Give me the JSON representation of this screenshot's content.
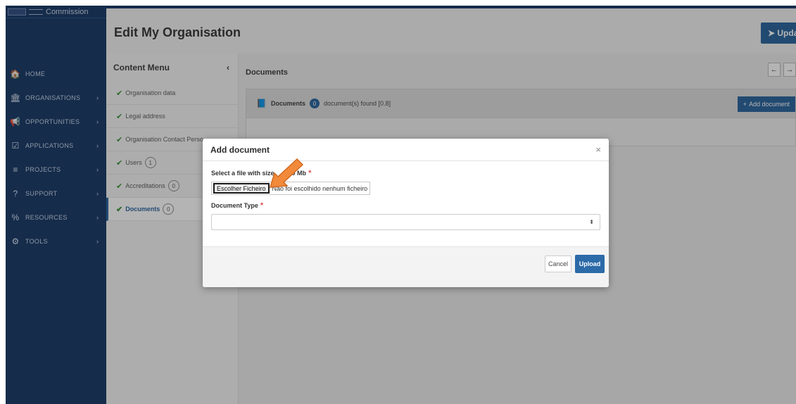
{
  "sidebar": {
    "logo_text": "Commission",
    "items": [
      {
        "icon": "home-icon",
        "glyph": "🏠",
        "label": "HOME",
        "chevron": ""
      },
      {
        "icon": "bank-icon",
        "glyph": "🏛",
        "label": "ORGANISATIONS",
        "chevron": "›"
      },
      {
        "icon": "megaphone-icon",
        "glyph": "📢",
        "label": "OPPORTUNITIES",
        "chevron": "›"
      },
      {
        "icon": "checklist-icon",
        "glyph": "☑",
        "label": "APPLICATIONS",
        "chevron": "›"
      },
      {
        "icon": "list-icon",
        "glyph": "≡",
        "label": "PROJECTS",
        "chevron": "›"
      },
      {
        "icon": "help-icon",
        "glyph": "?",
        "label": "SUPPORT",
        "chevron": "›"
      },
      {
        "icon": "link-icon",
        "glyph": "%",
        "label": "RESOURCES",
        "chevron": "›"
      },
      {
        "icon": "gears-icon",
        "glyph": "⚙",
        "label": "TOOLS",
        "chevron": "›"
      }
    ]
  },
  "header": {
    "title": "Edit My Organisation",
    "update_label": "Upda",
    "update_icon": "send-icon"
  },
  "content_menu": {
    "title": "Content Menu",
    "collapse_glyph": "‹",
    "items": [
      {
        "label": "Organisation data",
        "count": ""
      },
      {
        "label": "Legal address",
        "count": ""
      },
      {
        "label": "Organisation Contact Perso",
        "count": ""
      },
      {
        "label": "Users",
        "count": "1"
      },
      {
        "label": "Accreditations",
        "count": "0"
      },
      {
        "label": "Documents",
        "count": "0"
      }
    ]
  },
  "main": {
    "title": "Documents",
    "prev_glyph": "←",
    "next_glyph": "→",
    "panel_title": "Documents",
    "panel_count": "0",
    "panel_found": "document(s) found [0.8]",
    "add_document_label": "Add document",
    "add_plus": "+"
  },
  "modal": {
    "title": "Add document",
    "close_glyph": "×",
    "file_label": "Select a file with size",
    "file_label_suffix": "20 Mb",
    "required_mark": "*",
    "choose_file_label": "Escolher Ficheiro",
    "no_file_text": "Não foi escolhido nenhum ficheiro",
    "doc_type_label": "Document Type",
    "select_caret": "⬍",
    "cancel_label": "Cancel",
    "upload_label": "Upload"
  },
  "annotation": {
    "arrow_color": "#f28a3b",
    "arrow_stroke": "#d2691e"
  }
}
